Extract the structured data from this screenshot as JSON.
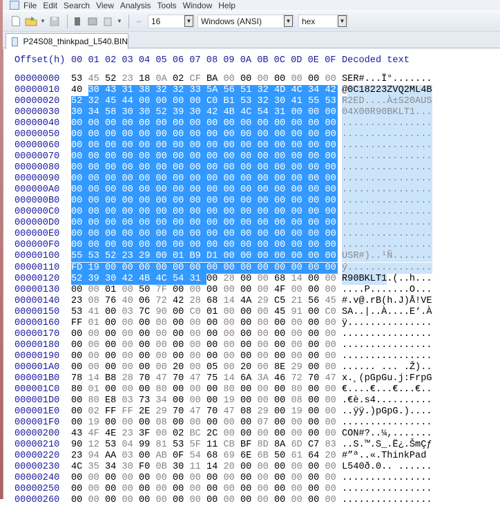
{
  "menu": [
    "File",
    "Edit",
    "Search",
    "View",
    "Analysis",
    "Tools",
    "Window",
    "Help"
  ],
  "toolbar": {
    "bytes_per_row": "16",
    "charset": "Windows (ANSI)",
    "offset_base": "hex"
  },
  "tab": {
    "title": "P24S08_thinkpad_L540.BIN"
  },
  "header": {
    "offset": "Offset(h)",
    "columns": "00 01 02 03 04 05 06 07 08 09 0A 0B 0C 0D 0E 0F",
    "decoded": "Decoded text"
  },
  "selection": {
    "start": 17,
    "end": 295
  },
  "colors": {
    "selection": "#3399ff",
    "offset_text": "#1a1aa0",
    "odd_byte": "#8a8080"
  },
  "rows": [
    {
      "offset": "00000000",
      "hex": "53 45 52 23 18 0A 02 CF BA 00 00 00 00 00 00 00",
      "text": "SER#...Ï°......."
    },
    {
      "offset": "00000010",
      "hex": "40 30 43 31 38 32 32 33 5A 56 51 32 4D 4C 34 42",
      "text": "@0C18223ZVQ2ML4B"
    },
    {
      "offset": "00000020",
      "hex": "52 32 45 44 00 00 00 00 C0 B1 53 32 30 41 55 53",
      "text": "R2ED....À±S20AUS"
    },
    {
      "offset": "00000030",
      "hex": "30 34 58 30 30 52 39 30 42 4B 4C 54 31 00 00 00",
      "text": "04X00R90BKLT1..."
    },
    {
      "offset": "00000040",
      "hex": "00 00 00 00 00 00 00 00 00 00 00 00 00 00 00 00",
      "text": "................"
    },
    {
      "offset": "00000050",
      "hex": "00 00 00 00 00 00 00 00 00 00 00 00 00 00 00 00",
      "text": "................"
    },
    {
      "offset": "00000060",
      "hex": "00 00 00 00 00 00 00 00 00 00 00 00 00 00 00 00",
      "text": "................"
    },
    {
      "offset": "00000070",
      "hex": "00 00 00 00 00 00 00 00 00 00 00 00 00 00 00 00",
      "text": "................"
    },
    {
      "offset": "00000080",
      "hex": "00 00 00 00 00 00 00 00 00 00 00 00 00 00 00 00",
      "text": "................"
    },
    {
      "offset": "00000090",
      "hex": "00 00 00 00 00 00 00 00 00 00 00 00 00 00 00 00",
      "text": "................"
    },
    {
      "offset": "000000A0",
      "hex": "00 00 00 00 00 00 00 00 00 00 00 00 00 00 00 00",
      "text": "................"
    },
    {
      "offset": "000000B0",
      "hex": "00 00 00 00 00 00 00 00 00 00 00 00 00 00 00 00",
      "text": "................"
    },
    {
      "offset": "000000C0",
      "hex": "00 00 00 00 00 00 00 00 00 00 00 00 00 00 00 00",
      "text": "................"
    },
    {
      "offset": "000000D0",
      "hex": "00 00 00 00 00 00 00 00 00 00 00 00 00 00 00 00",
      "text": "................"
    },
    {
      "offset": "000000E0",
      "hex": "00 00 00 00 00 00 00 00 00 00 00 00 00 00 00 00",
      "text": "................"
    },
    {
      "offset": "000000F0",
      "hex": "00 00 00 00 00 00 00 00 00 00 00 00 00 00 00 00",
      "text": "................"
    },
    {
      "offset": "00000100",
      "hex": "55 53 52 23 29 00 01 B9 D1 00 00 00 00 00 00 00",
      "text": "USR#)..¹Ñ......."
    },
    {
      "offset": "00000110",
      "hex": "FD 19 00 00 00 00 00 00 00 00 00 00 00 00 00 00",
      "text": "ý..............."
    },
    {
      "offset": "00000120",
      "hex": "52 39 30 42 4B 4C 54 31 00 28 00 00 68 14 00 00",
      "text": "R90BKLT1.(..h..."
    },
    {
      "offset": "00000130",
      "hex": "00 00 01 00 50 7F 00 00 00 00 00 00 4F 00 00 00",
      "text": "....P.......O..."
    },
    {
      "offset": "00000140",
      "hex": "23 08 76 40 06 72 42 28 68 14 4A 29 C5 21 56 45",
      "text": "#.v@.rB(h.J)Å!VE"
    },
    {
      "offset": "00000150",
      "hex": "53 41 00 03 7C 90 00 C0 01 00 00 00 45 91 00 C0",
      "text": "SA..|..À....E‘.À"
    },
    {
      "offset": "00000160",
      "hex": "FF 01 00 00 00 00 00 00 00 00 00 00 00 00 00 00",
      "text": "ÿ..............."
    },
    {
      "offset": "00000170",
      "hex": "00 00 00 00 00 00 00 00 00 00 00 00 00 00 00 00",
      "text": "................"
    },
    {
      "offset": "00000180",
      "hex": "00 00 00 00 00 00 00 00 00 00 00 00 00 00 00 00",
      "text": "................"
    },
    {
      "offset": "00000190",
      "hex": "00 00 00 00 00 00 00 00 00 00 00 00 00 00 00 00",
      "text": "................"
    },
    {
      "offset": "000001A0",
      "hex": "00 00 00 00 00 00 20 00 05 00 20 00 8E 29 00 00",
      "text": "...... ... .Ž).."
    },
    {
      "offset": "000001B0",
      "hex": "78 14 B8 28 70 47 70 47 75 14 6A 3A 46 72 70 47",
      "text": "x.¸(pGpGu.j:FrpG"
    },
    {
      "offset": "000001C0",
      "hex": "80 01 00 00 00 80 00 00 00 80 00 00 00 80 00 00",
      "text": "€....€...€...€.."
    },
    {
      "offset": "000001D0",
      "hex": "00 80 E8 03 73 34 00 00 00 19 00 00 00 08 00 00",
      "text": ".€è.s4.........."
    },
    {
      "offset": "000001E0",
      "hex": "00 02 FF FF 2E 29 70 47 70 47 08 29 00 19 00 00",
      "text": "..ÿÿ.)pGpG.)...."
    },
    {
      "offset": "000001F0",
      "hex": "00 19 00 00 00 08 00 00 00 00 00 07 00 00 00 00",
      "text": "................"
    },
    {
      "offset": "00000200",
      "hex": "43 4F 4E 23 3F 00 02 BC 2C 00 00 00 00 00 00 00",
      "text": "CON#?..¼,......."
    },
    {
      "offset": "00000210",
      "hex": "90 12 53 04 99 81 53 5F 11 CB BF 8D 8A 6D C7 83",
      "text": "..S.™.S_.Ë¿.ŠmÇƒ"
    },
    {
      "offset": "00000220",
      "hex": "23 94 AA 03 00 AB 0F 54 68 69 6E 6B 50 61 64 20",
      "text": "#”ª..«.ThinkPad "
    },
    {
      "offset": "00000230",
      "hex": "4C 35 34 30 F0 0B 30 11 14 20 00 00 00 00 00 00",
      "text": "L540ð.0.. ......"
    },
    {
      "offset": "00000240",
      "hex": "00 00 00 00 00 00 00 00 00 00 00 00 00 00 00 00",
      "text": "................"
    },
    {
      "offset": "00000250",
      "hex": "00 00 00 00 00 00 00 00 00 00 00 00 00 00 00 00",
      "text": "................"
    },
    {
      "offset": "00000260",
      "hex": "00 00 00 00 00 00 00 00 00 00 00 00 00 00 00 00",
      "text": "................"
    }
  ]
}
